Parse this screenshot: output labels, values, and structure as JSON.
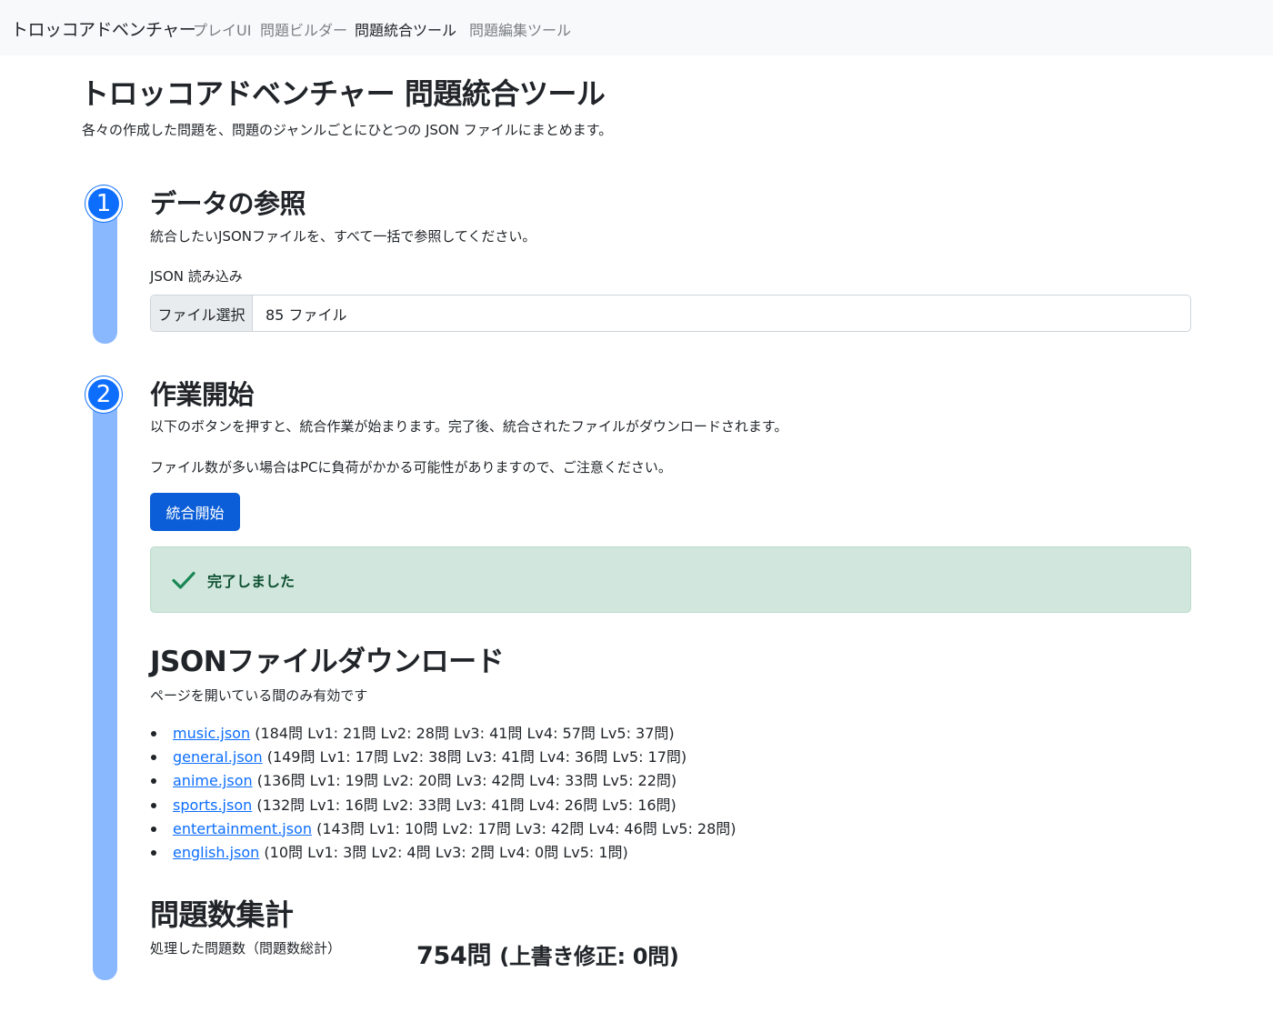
{
  "navbar": {
    "brand": "トロッコアドベンチャー",
    "links": [
      {
        "label": "プレイUI",
        "active": false
      },
      {
        "label": "問題ビルダー",
        "active": false
      },
      {
        "label": "問題統合ツール",
        "active": true
      },
      {
        "label": "問題編集ツール",
        "active": false
      }
    ]
  },
  "header": {
    "title": "トロッコアドベンチャー 問題統合ツール",
    "subtitle": "各々の作成した問題を、問題のジャンルごとにひとつの JSON ファイルにまとめます。"
  },
  "step1": {
    "number": "1",
    "title": "データの参照",
    "description": "統合したいJSONファイルを、すべて一括で参照してください。",
    "input_label": "JSON 読み込み",
    "file_button": "ファイル選択",
    "file_value": "85 ファイル"
  },
  "step2": {
    "number": "2",
    "title": "作業開始",
    "description1": "以下のボタンを押すと、統合作業が始まります。完了後、統合されたファイルがダウンロードされます。",
    "description2": "ファイル数が多い場合はPCに負荷がかかる可能性がありますので、ご注意ください。",
    "start_button": "統合開始",
    "alert_text": "完了しました",
    "alert_color": "#d1e7dd"
  },
  "download": {
    "title": "JSONファイルダウンロード",
    "note": "ページを開いている間のみ有効です",
    "files": [
      {
        "name": "music.json",
        "detail": " (184問 Lv1: 21問 Lv2: 28問 Lv3: 41問 Lv4: 57問 Lv5: 37問)"
      },
      {
        "name": "general.json",
        "detail": " (149問 Lv1: 17問 Lv2: 38問 Lv3: 41問 Lv4: 36問 Lv5: 17問)"
      },
      {
        "name": "anime.json",
        "detail": " (136問 Lv1: 19問 Lv2: 20問 Lv3: 42問 Lv4: 33問 Lv5: 22問)"
      },
      {
        "name": "sports.json",
        "detail": " (132問 Lv1: 16問 Lv2: 33問 Lv3: 41問 Lv4: 26問 Lv5: 16問)"
      },
      {
        "name": "entertainment.json",
        "detail": " (143問 Lv1: 10問 Lv2: 17問 Lv3: 42問 Lv4: 46問 Lv5: 28問)"
      },
      {
        "name": "english.json",
        "detail": " (10問 Lv1: 3問 Lv2: 4問 Lv3: 2問 Lv4: 0問 Lv5: 1問)"
      }
    ]
  },
  "summary": {
    "title": "問題数集計",
    "label": "処理した問題数（問題数総計）",
    "total": "754問",
    "overwrite": "(上書き修正: 0問)"
  },
  "colors": {
    "primary": "#0d6efd",
    "rail": "#8ab8ff",
    "success_text": "#0f5132"
  }
}
